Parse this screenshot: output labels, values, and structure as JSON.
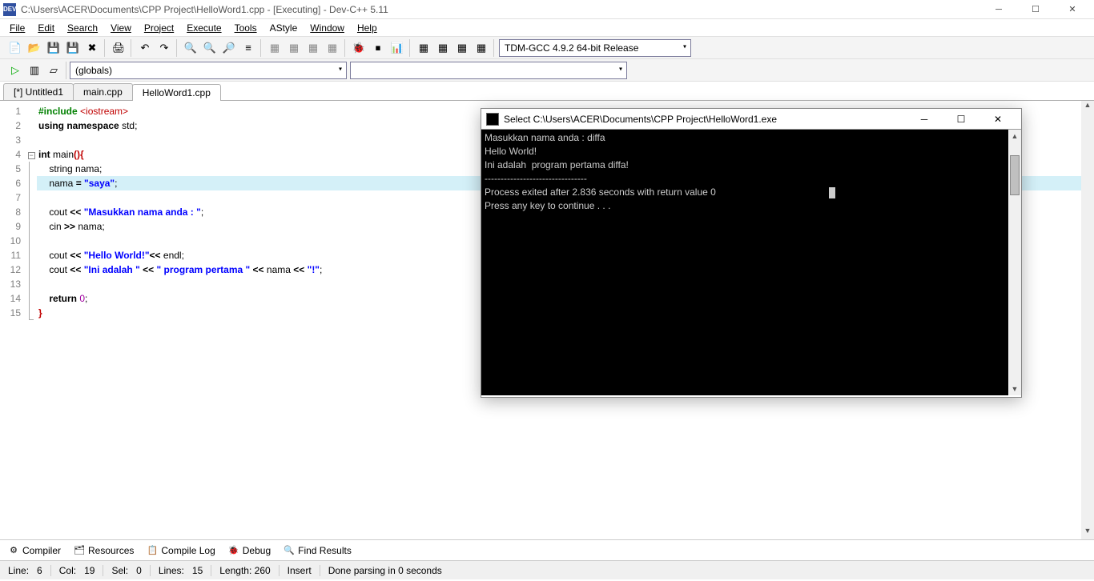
{
  "window": {
    "title": "C:\\Users\\ACER\\Documents\\CPP Project\\HelloWord1.cpp - [Executing] - Dev-C++ 5.11"
  },
  "menubar": [
    "File",
    "Edit",
    "Search",
    "View",
    "Project",
    "Execute",
    "Tools",
    "AStyle",
    "Window",
    "Help"
  ],
  "toolbar1": {
    "compiler_combo": "TDM-GCC 4.9.2 64-bit Release"
  },
  "toolbar2": {
    "globals_combo": "(globals)"
  },
  "tabs": [
    {
      "label": "[*] Untitled1",
      "active": false
    },
    {
      "label": "main.cpp",
      "active": false
    },
    {
      "label": "HelloWord1.cpp",
      "active": true
    }
  ],
  "gutter_lines": [
    "1",
    "2",
    "3",
    "4",
    "5",
    "6",
    "7",
    "8",
    "9",
    "10",
    "11",
    "12",
    "13",
    "14",
    "15"
  ],
  "fold_marks": {
    "line4": "−"
  },
  "code_tokens": {
    "l1a": "#include ",
    "l1b": "<iostream>",
    "l2a": "using ",
    "l2b": "namespace ",
    "l2c": "std;",
    "l4a": "int ",
    "l4b": "main",
    "l4c": "()",
    "l4d": "{",
    "l5a": "    string nama",
    "l6a": "    nama ",
    "l6b": "= ",
    "l6c": "\"saya\"",
    "l8a": "    cout ",
    "l8b": "<< ",
    "l8c": "\"Masukkan nama anda : \"",
    "l9a": "    cin ",
    "l9b": ">> ",
    "l9c": "nama",
    "l11a": "    cout ",
    "l11b": "<< ",
    "l11c": "\"Hello World!\"",
    "l11d": "<< ",
    "l11e": "endl",
    "l12a": "    cout ",
    "l12b": "<< ",
    "l12c": "\"Ini adalah \"",
    "l12d": " << ",
    "l12e": "\" program pertama \"",
    "l12f": " << ",
    "l12g": "nama",
    "l12h": " << ",
    "l12i": "\"!\"",
    "l14a": "    ",
    "l14b": "return ",
    "l14c": "0",
    "l15a": "}",
    "semi": ";"
  },
  "bottom_tabs": [
    "Compiler",
    "Resources",
    "Compile Log",
    "Debug",
    "Find Results"
  ],
  "status": {
    "line_lbl": "Line:",
    "line": "6",
    "col_lbl": "Col:",
    "col": "19",
    "sel_lbl": "Sel:",
    "sel": "0",
    "lines_lbl": "Lines:",
    "lines": "15",
    "length_lbl": "Length:",
    "length": "260",
    "insert": "Insert",
    "parse": "Done parsing in 0 seconds"
  },
  "console": {
    "title": "Select C:\\Users\\ACER\\Documents\\CPP Project\\HelloWord1.exe",
    "l1": "Masukkan nama anda : diffa",
    "l2": "Hello World!",
    "l3": "Ini adalah  program pertama diffa!",
    "l4": "--------------------------------",
    "l5": "Process exited after 2.836 seconds with return value 0",
    "l6": "Press any key to continue . . . "
  }
}
